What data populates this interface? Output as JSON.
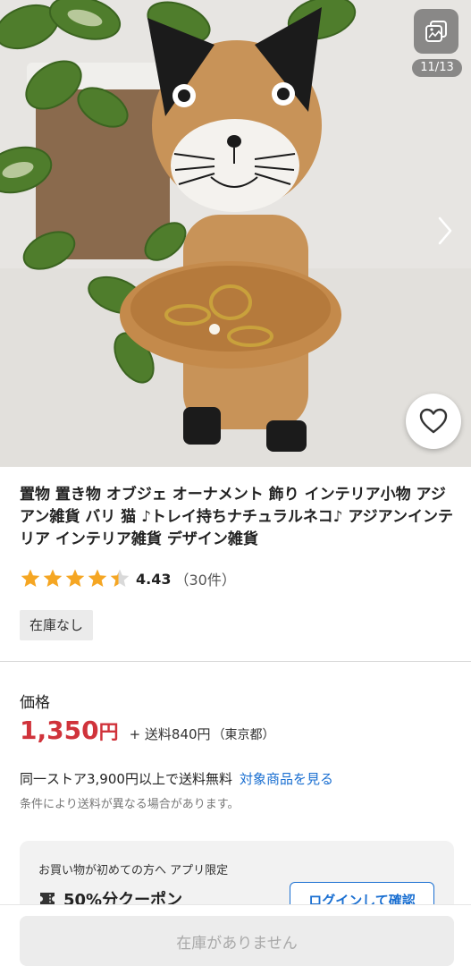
{
  "gallery": {
    "counter": "11/13",
    "icons": {
      "gallery": "image-stack-icon",
      "next": "chevron-right-icon",
      "favorite": "heart-outline-icon"
    }
  },
  "product": {
    "title": "置物 置き物 オブジェ オーナメント 飾り インテリア小物 アジアン雑貨 バリ 猫 ♪トレイ持ちナチュラルネコ♪ アジアンインテリア インテリア雑貨 デザイン雑貨",
    "rating": {
      "value": "4.43",
      "count": "（30件）",
      "stars": 4.43,
      "star_color": "#f5a623"
    },
    "stock_badge": "在庫なし"
  },
  "price": {
    "label": "価格",
    "amount": "1,350",
    "currency": "円",
    "shipping": "+ 送料840円",
    "shipping_region": "（東京都）",
    "accent_color": "#d0333b"
  },
  "shipping_info": {
    "free_text": "同一ストア3,900円以上で送料無料",
    "link": "対象商品を見る",
    "note": "条件により送料が異なる場合があります。"
  },
  "coupon": {
    "headline": "お買い物が初めての方へ アプリ限定",
    "title": "50%分クーポン",
    "button": "ログインして確認",
    "ticket_icon": "ticket-icon"
  },
  "bottom": {
    "button": "在庫がありません"
  }
}
